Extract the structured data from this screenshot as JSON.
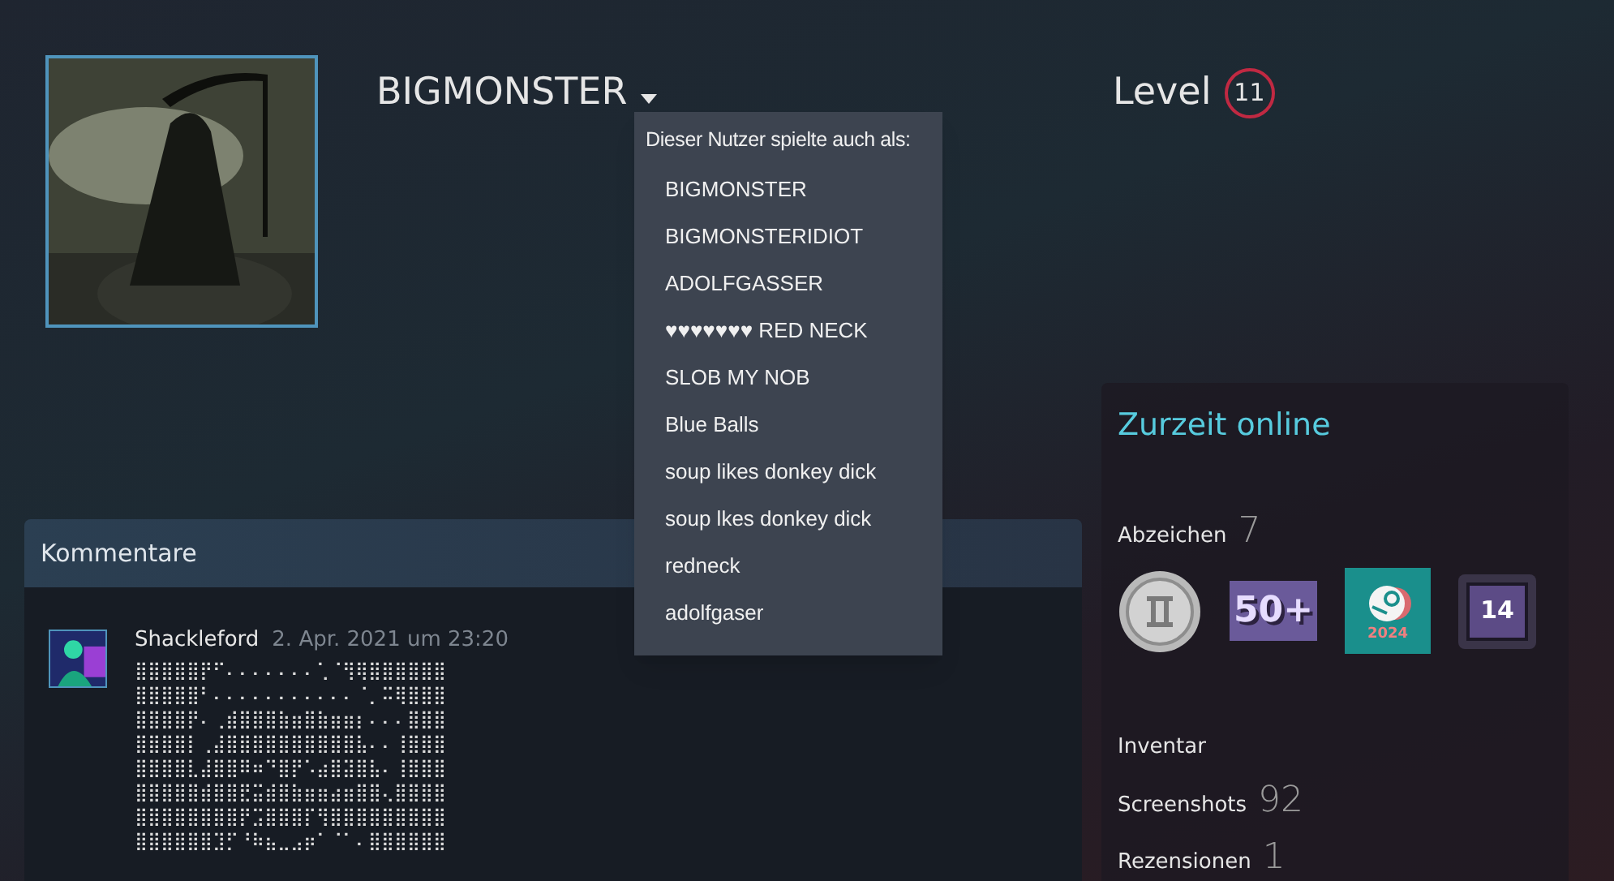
{
  "profile": {
    "name": "BIGMONSTER",
    "level_label": "Level",
    "level": "11"
  },
  "alias_menu": {
    "title": "Dieser Nutzer spielte auch als:",
    "items": [
      "BIGMONSTER",
      "BIGMONSTERIDIOT",
      "ADOLFGASSER",
      "♥♥♥♥♥♥♥ RED NECK",
      "SLOB MY NOB",
      "Blue Balls",
      "soup likes donkey dick",
      "soup lkes donkey dick",
      "redneck",
      "adolfgaser"
    ]
  },
  "status": "Zurzeit online",
  "stats": [
    {
      "kind": "badges",
      "label": "Abzeichen",
      "count": "7",
      "badges": [
        {
          "kind": "coin"
        },
        {
          "kind": "label",
          "text": "50+"
        },
        {
          "kind": "steam",
          "text": "2024"
        },
        {
          "kind": "frame",
          "text": "14"
        }
      ]
    },
    {
      "kind": "plain",
      "label": "Inventar"
    },
    {
      "kind": "count",
      "label": "Screenshots",
      "count": "92"
    },
    {
      "kind": "count",
      "label": "Rezensionen",
      "count": "1"
    }
  ],
  "comments": {
    "title": "Kommentare",
    "items": [
      {
        "author": "Shackleford",
        "date": "2. Apr. 2021 um 23:20",
        "lines": [
          "⣿⣿⣿⣿⣿⡟⠋⠄⠄⠄⠄⠄⠄⠄⢁⠈⢻⢿⣿⣿⣿⣿⣿⣿",
          "⣿⣿⣿⣿⣿⠃⠄⠄⠄⠄⠄⠄⠄⠄⠄⠄⠄⠈⡀⠭⢿⣿⣿⣿",
          "⣿⣿⣿⣿⡟⠄⢀⣾⣿⣿⣿⣷⣶⣿⣷⣶⣶⡆⠄⠄⠄⣿⣿⣿",
          "⣿⣿⣿⣿⡇⢀⣼⣿⣿⣿⣿⣿⣿⣿⣿⣿⣿⣧⠄⠄⢸⣿⣿⣿",
          "⣿⣿⣿⣿⣇⣼⣿⣿⠿⠶⠙⣿⡟⠡⣴⣿⣽⣿⣧⠄⢸⣿⣿⣿",
          "⣿⣿⣿⣿⣿⣾⣿⣿⣟⣭⣾⣿⣷⣶⣶⣴⣶⣿⣿⢄⣿⣿⣿⣿",
          "⣿⣿⣿⣿⣿⣿⣿⣿⡟⣩⣿⣿⣿⡏⢻⣿⣿⣿⣿⣿⣿⣿⣿⣿",
          "⣿⣿⣿⣿⣿⣿⣹⡋⠘⠷⣦⣀⣠⡶⠁⠈⠁⠄⣿⣿⣿⣿⣿⣿"
        ]
      }
    ]
  }
}
